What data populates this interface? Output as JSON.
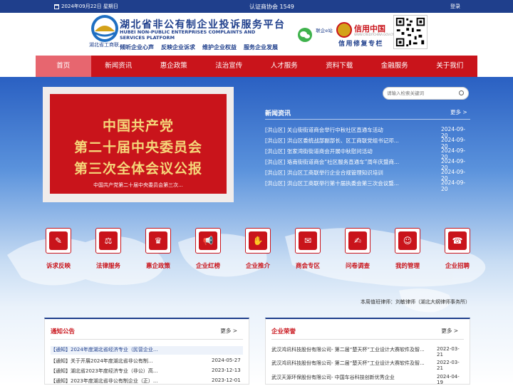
{
  "topbar": {
    "date": "2024年09月22日 星期日",
    "verify": "认证商协会 1549",
    "login": "登录"
  },
  "header": {
    "title_cn": "湖北省非公有制企业投诉服务平台",
    "title_en": "HUBEI NON-PUBLIC ENTERPRISES COMPLAINTS AND SERVICES PLATFORM",
    "slogans": [
      "倾听企业心声",
      "反映企业诉求",
      "维护企业权益",
      "服务企业发展"
    ],
    "logo_text": "湖北省工商联",
    "wechat_label": "联企e站",
    "credit_brand": "信用中国",
    "credit_url": "WWW.CREDITCHINA.GOV.CN",
    "credit_special": "信用修复专栏"
  },
  "nav": {
    "items": [
      "首页",
      "新闻资讯",
      "惠企政策",
      "法治宣传",
      "人才服务",
      "资料下载",
      "金融服务",
      "关于我们"
    ],
    "active": 0
  },
  "banner": {
    "lines": [
      "中国共产党",
      "第二十届中央委员会",
      "第三次全体会议公报"
    ],
    "caption": "中国共产党第二十届中央委员会第三次..."
  },
  "search": {
    "placeholder": "请输入检索关键词"
  },
  "news": {
    "title": "新闻资讯",
    "more": "更多 >",
    "items": [
      {
        "text": "[洪山区] 关山街街道商会举行中秋社区直通车活动",
        "date": "2024-09-20"
      },
      {
        "text": "[洪山区] 洪山区委统战部副部长、区工商联党组书记邓...",
        "date": "2024-09-20"
      },
      {
        "text": "[洪山区] 张家湾街街道商会开展中秋慰问活动",
        "date": "2024-09-20"
      },
      {
        "text": "[洪山区] 珞南街街道商会“社区服务直通车”周年庆暨商...",
        "date": "2024-09-20"
      },
      {
        "text": "[洪山区] 洪山区工商联举行企业合规管理知识培训",
        "date": "2024-09-20"
      },
      {
        "text": "[洪山区] 洪山区工商联举行第十届执委会第三次会议暨...",
        "date": "2024-09-20"
      }
    ]
  },
  "services": [
    {
      "label": "诉求反映",
      "icon": "edit-icon",
      "glyph": "✎"
    },
    {
      "label": "法律服务",
      "icon": "gavel-icon",
      "glyph": "⚖"
    },
    {
      "label": "惠企政策",
      "icon": "trophy-icon",
      "glyph": "♛"
    },
    {
      "label": "企业红榜",
      "icon": "megaphone-icon",
      "glyph": "📢"
    },
    {
      "label": "企业推介",
      "icon": "handshake-icon",
      "glyph": "✋"
    },
    {
      "label": "商会专区",
      "icon": "chat-icon",
      "glyph": "✉"
    },
    {
      "label": "问卷调查",
      "icon": "survey-icon",
      "glyph": "✍"
    },
    {
      "label": "我的管理",
      "icon": "user-icon",
      "glyph": "☺"
    },
    {
      "label": "企业招聘",
      "icon": "recruit-icon",
      "glyph": "☎"
    }
  ],
  "lawyer_text": "本周值班律师：刘敏律师（湖北大纲律师事务所）",
  "notices": {
    "title": "通知公告",
    "more": "更多 >",
    "items": [
      {
        "text": "【通知】2024年度湖北省经济专业（民营企业...",
        "date": "",
        "highlight": true
      },
      {
        "text": "【通知】关于开展2024年度湖北省非公有制...",
        "date": "2024-05-27",
        "highlight": false
      },
      {
        "text": "【通知】湖北省2023年度经济专业（非公）高...",
        "date": "2023-12-13",
        "highlight": false
      },
      {
        "text": "【通知】2023年度湖北省非公有制企业（正）...",
        "date": "2023-12-01",
        "highlight": false
      }
    ]
  },
  "honors": {
    "title": "企业荣誉",
    "more": "更多 >",
    "items": [
      {
        "text": "武汉鸿讯科技股份有限公司- 第二届“楚天杯”工业设计大赛软件及智...",
        "date": "2022-03-21"
      },
      {
        "text": "武汉鸿讯科技股份有限公司- 第二届“楚天杯”工业设计大赛软件及智...",
        "date": "2022-03-21"
      },
      {
        "text": "武汉天源环保股份有限公司- 中国车谷科技创新优秀企业",
        "date": "2024-04-19"
      }
    ]
  },
  "colors": {
    "brand_blue": "#1f3f8c",
    "brand_red": "#c9141b",
    "nav_active": "#e7666f",
    "banner_gold": "#f5d77a"
  }
}
